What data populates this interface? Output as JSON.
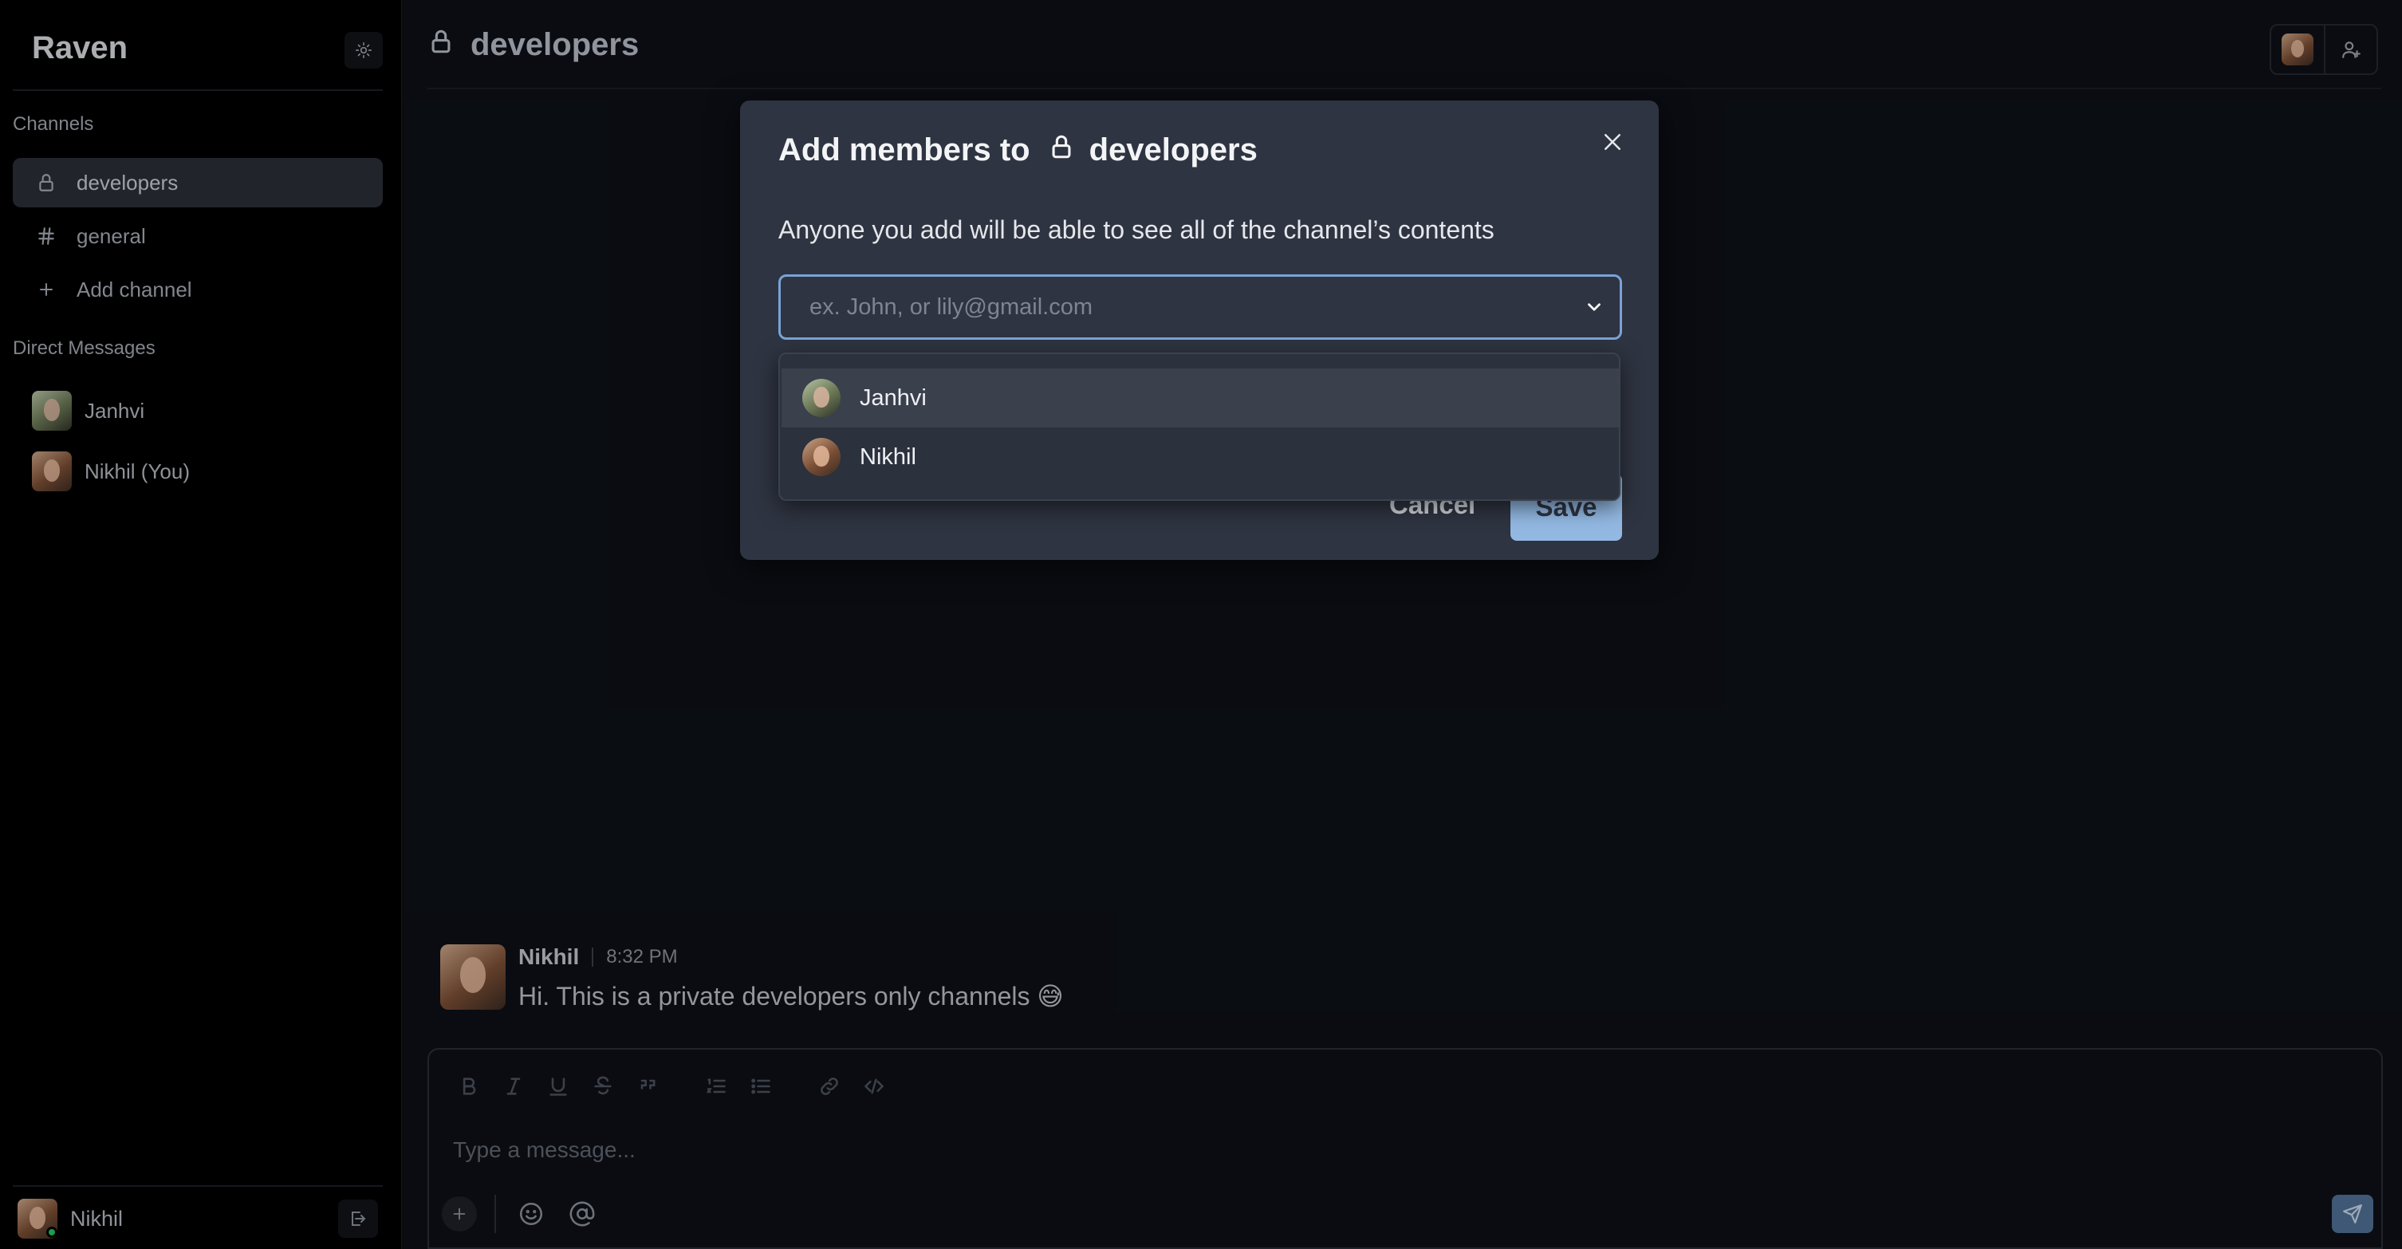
{
  "app": {
    "name": "Raven"
  },
  "sidebar": {
    "channels_label": "Channels",
    "channels": [
      {
        "name": "developers",
        "icon": "lock-icon",
        "active": true
      },
      {
        "name": "general",
        "icon": "hash-icon",
        "active": false
      }
    ],
    "add_channel_label": "Add channel",
    "dm_label": "Direct Messages",
    "direct_messages": [
      {
        "name": "Janhvi"
      },
      {
        "name": "Nikhil (You)"
      }
    ],
    "current_user": {
      "name": "Nikhil",
      "status": "online"
    }
  },
  "header": {
    "channel_name": "developers"
  },
  "messages": [
    {
      "author": "Nikhil",
      "time": "8:32 PM",
      "text": "Hi. This is a private developers only channels 😅"
    }
  ],
  "composer": {
    "placeholder": "Type a message..."
  },
  "modal": {
    "title_prefix": "Add members to",
    "channel_name": "developers",
    "description": "Anyone you add will be able to see all of the channel’s contents",
    "input_placeholder": "ex. John, or lily@gmail.com",
    "options": [
      {
        "name": "Janhvi",
        "highlighted": true
      },
      {
        "name": "Nikhil",
        "highlighted": false
      }
    ],
    "cancel_label": "Cancel",
    "save_label": "Save"
  },
  "colors": {
    "accent": "#93b9e3",
    "focus_ring": "#7aa3d6",
    "modal_bg": "#2e3441",
    "send_button": "#4f6e93",
    "online": "#22c55e"
  }
}
